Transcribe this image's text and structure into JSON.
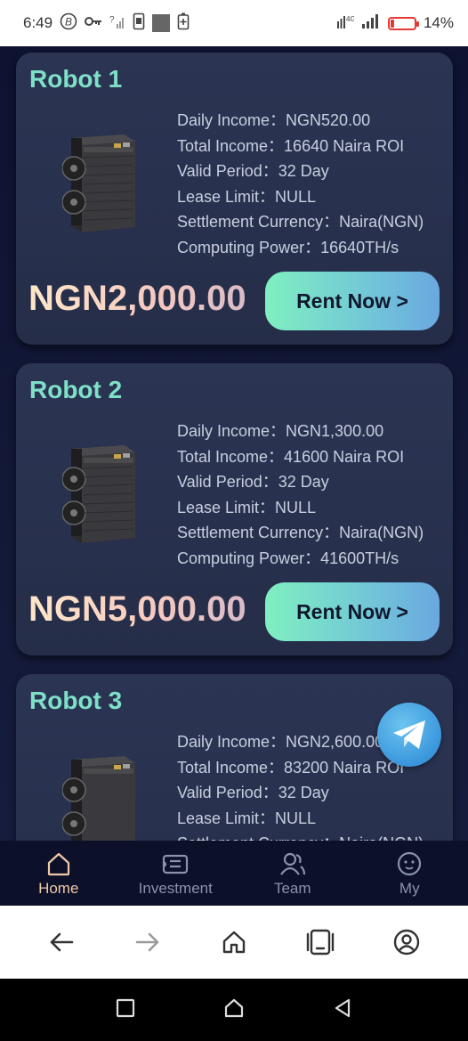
{
  "status_bar": {
    "time": "6:49",
    "battery_percent": "14%",
    "battery_level": 0.14
  },
  "cards": [
    {
      "title": "Robot 1",
      "specs": [
        "Daily Income：NGN520.00",
        "Total Income：16640 Naira ROI",
        "Valid Period：32 Day",
        "Lease Limit：NULL",
        "Settlement Currency：Naira(NGN)",
        "Computing Power：16640TH/s"
      ],
      "price": "NGN2,000.00",
      "button": "Rent Now >"
    },
    {
      "title": "Robot 2",
      "specs": [
        "Daily Income：NGN1,300.00",
        "Total Income：41600 Naira ROI",
        "Valid Period：32 Day",
        "Lease Limit：NULL",
        "Settlement Currency：Naira(NGN)",
        "Computing Power：41600TH/s"
      ],
      "price": "NGN5,000.00",
      "button": "Rent Now >"
    },
    {
      "title": "Robot 3",
      "specs": [
        "Daily Income：NGN2,600.00",
        "Total Income：83200 Naira ROI",
        "Valid Period：32 Day",
        "Lease Limit：NULL",
        "Settlement Currency：Naira(NGN)"
      ]
    }
  ],
  "tabs": [
    {
      "label": "Home",
      "icon": "home-icon",
      "active": true
    },
    {
      "label": "Investment",
      "icon": "wallet-icon",
      "active": false
    },
    {
      "label": "Team",
      "icon": "team-icon",
      "active": false
    },
    {
      "label": "My",
      "icon": "profile-icon",
      "active": false
    }
  ],
  "colors": {
    "title": "#7fe0c8",
    "active_tab": "#f0c9a8",
    "button_gradient_start": "#7ff0c0",
    "button_gradient_end": "#6aa8e0"
  }
}
